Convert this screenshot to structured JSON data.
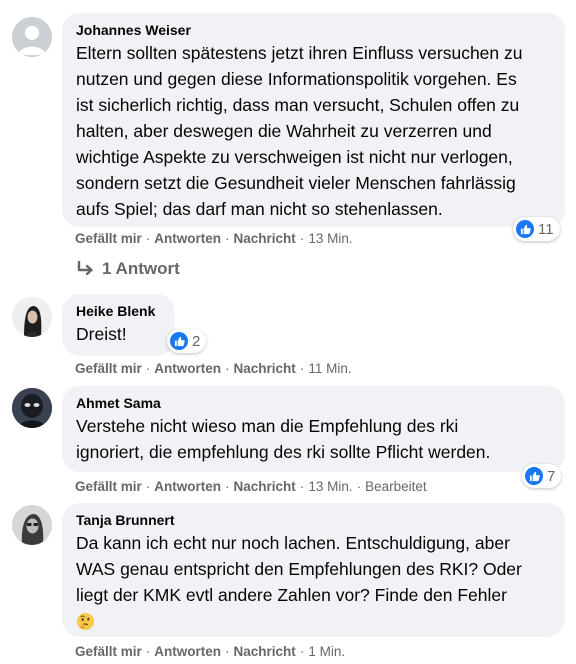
{
  "comments": [
    {
      "author": "Johannes Weiser",
      "lines": [
        "Eltern sollten spätestens jetzt ihren Einfluss versuchen zu",
        "nutzen und gegen diese Informationspolitik vorgehen. Es",
        "ist sicherlich richtig, dass man versucht, Schulen offen zu",
        "halten, aber deswegen die Wahrheit zu verzerren und",
        "wichtige Aspekte zu verschweigen ist nicht nur verlogen,",
        "sondern setzt die Gesundheit vieler Menschen fahrlässig",
        "aufs Spiel; das darf man nicht so stehenlassen."
      ],
      "reaction_count": "11",
      "time": "13 Min.",
      "edited": ""
    },
    {
      "author": "Heike Blenk",
      "lines": [
        "Dreist!"
      ],
      "reaction_count": "2",
      "time": "11 Min.",
      "edited": ""
    },
    {
      "author": "Ahmet Sama",
      "lines": [
        "Verstehe nicht wieso man die Empfehlung des rki",
        "ignoriert, die empfehlung des rki sollte Pflicht werden."
      ],
      "reaction_count": "7",
      "time": "13 Min.",
      "edited": "Bearbeitet"
    },
    {
      "author": "Tanja Brunnert",
      "lines": [
        "Da kann ich echt nur noch lachen. Entschuldigung, aber",
        "WAS genau entspricht den Empfehlungen des RKI? Oder",
        "liegt der KMK evtl andere Zahlen vor? Finde den Fehler"
      ],
      "emoji": "thinking-face",
      "time": "1 Min.",
      "edited": ""
    }
  ],
  "actions": {
    "like": "Gefällt mir",
    "reply": "Antworten",
    "message": "Nachricht",
    "dot": "·"
  },
  "replies_link": "1 Antwort",
  "colors": {
    "bubble": "#f0f2f5",
    "like_blue": "#1877f2",
    "meta_gray": "#65676b",
    "text": "#050505"
  }
}
